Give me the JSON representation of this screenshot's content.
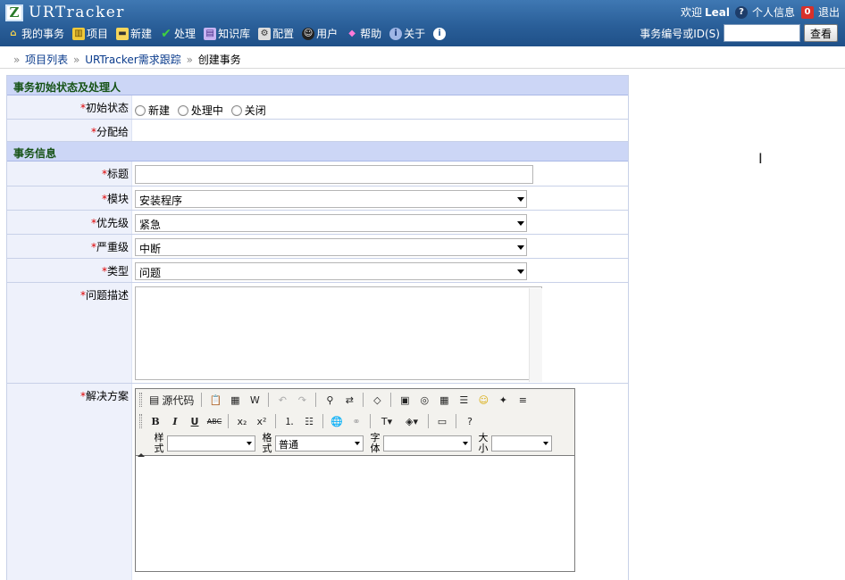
{
  "header": {
    "logo_text": "URTracker",
    "welcome": "欢迎",
    "username": "Leal",
    "profile_label": "个人信息",
    "logout_label": "退出",
    "search_label": "事务编号或ID(S)",
    "search_value": "",
    "search_button": "查看",
    "nav": [
      {
        "label": "我的事务",
        "icon": "home-icon"
      },
      {
        "label": "项目",
        "icon": "project-icon"
      },
      {
        "label": "新建",
        "icon": "new-icon"
      },
      {
        "label": "处理",
        "icon": "check-icon"
      },
      {
        "label": "知识库",
        "icon": "book-icon"
      },
      {
        "label": "配置",
        "icon": "config-icon"
      },
      {
        "label": "用户",
        "icon": "users-icon"
      },
      {
        "label": "帮助",
        "icon": "help-icon"
      },
      {
        "label": "关于",
        "icon": "about-icon"
      },
      {
        "label": "",
        "icon": "info-icon"
      }
    ]
  },
  "breadcrumb": {
    "items": [
      "项目列表",
      "URTracker需求跟踪",
      "创建事务"
    ]
  },
  "form": {
    "section1": "事务初始状态及处理人",
    "initial_state_label": "初始状态",
    "initial_state_options": [
      "新建",
      "处理中",
      "关闭"
    ],
    "assign_label": "分配给",
    "section2": "事务信息",
    "title_label": "标题",
    "title_value": "",
    "module_label": "模块",
    "module_value": "安装程序",
    "priority_label": "优先级",
    "priority_value": "紧急",
    "severity_label": "严重级",
    "severity_value": "中断",
    "type_label": "类型",
    "type_value": "问题",
    "description_label": "问题描述",
    "solution_label": "解决方案"
  },
  "editor": {
    "source_label": "源代码",
    "style_label": "样式",
    "format_label": "格式",
    "format_value": "普通",
    "font_label": "字体",
    "size_label": "大小",
    "bold": "B",
    "italic": "I",
    "underline": "U",
    "strike": "ABC"
  },
  "colors": {
    "header_bg": "#2a5f99",
    "section_bg": "#ccd6f6",
    "section_text": "#155215",
    "label_bg": "#eef1fb",
    "required": "#dd0000"
  }
}
